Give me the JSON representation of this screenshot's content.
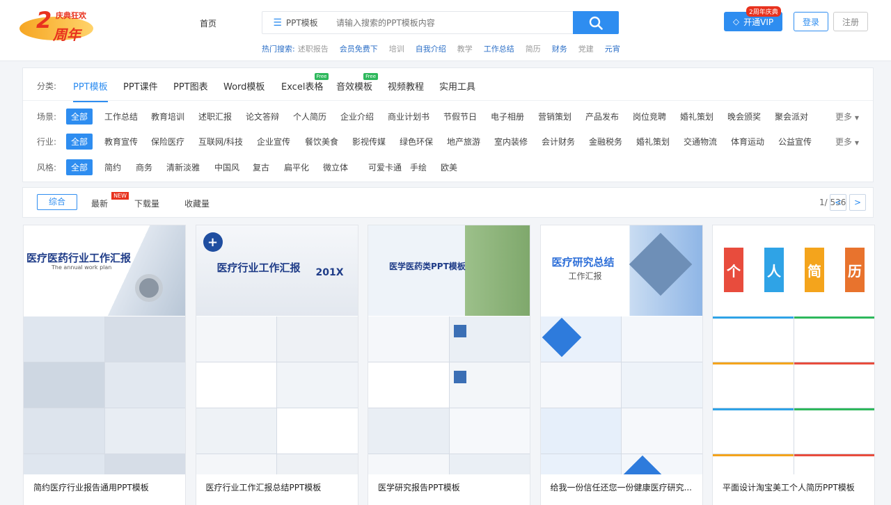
{
  "header": {
    "logo": {
      "caption": "庆典狂欢",
      "number": "2",
      "text": "周年"
    },
    "home": "首页",
    "search": {
      "category": "PPT模板",
      "placeholder": "请输入搜索的PPT模板内容"
    },
    "hot_label": "热门搜索:",
    "hot": [
      {
        "text": "述职报告",
        "style": "g"
      },
      {
        "text": "会员免费下",
        "style": "b"
      },
      {
        "text": "培训",
        "style": "g"
      },
      {
        "text": "自我介绍",
        "style": "b"
      },
      {
        "text": "教学",
        "style": "g"
      },
      {
        "text": "工作总结",
        "style": "b"
      },
      {
        "text": "简历",
        "style": "g"
      },
      {
        "text": "财务",
        "style": "b"
      },
      {
        "text": "党建",
        "style": "g"
      },
      {
        "text": "元宵",
        "style": "b"
      }
    ],
    "vip": {
      "label": "开通VIP",
      "tag": "2周年庆典"
    },
    "login": "登录",
    "register": "注册"
  },
  "filters": {
    "category_label": "分类:",
    "tabs": [
      "PPT模板",
      "PPT课件",
      "PPT图表",
      "Word模板",
      "Excel表格",
      "音效模板",
      "视频教程",
      "实用工具"
    ],
    "free_badge": "Free",
    "scene_label": "场景:",
    "scene": [
      "全部",
      "工作总结",
      "教育培训",
      "述职汇报",
      "论文答辩",
      "个人简历",
      "企业介绍",
      "商业计划书",
      "节假节日",
      "电子相册",
      "营销策划",
      "产品发布",
      "岗位竞聘",
      "婚礼策划",
      "晚会颁奖",
      "聚会派对"
    ],
    "industry_label": "行业:",
    "industry": [
      "全部",
      "教育宣传",
      "保险医疗",
      "互联网/科技",
      "企业宣传",
      "餐饮美食",
      "影视传媒",
      "绿色环保",
      "地产旅游",
      "室内装修",
      "会计财务",
      "金融税务",
      "婚礼策划",
      "交通物流",
      "体育运动",
      "公益宣传"
    ],
    "style_label": "风格:",
    "style": [
      "全部",
      "简约",
      "商务",
      "清新淡雅",
      "中国风",
      "复古",
      "扁平化",
      "微立体",
      "可爱卡通",
      "手绘",
      "欧美"
    ],
    "more": "更多"
  },
  "sort": {
    "options": [
      "综合",
      "最新",
      "下载量",
      "收藏量"
    ],
    "new_badge": "NEW",
    "page": "1/ 536",
    "prev": "<",
    "next": ">"
  },
  "cards": [
    {
      "title": "简约医疗行业报告通用PPT模板",
      "cover_title": "医疗医药行业工作汇报",
      "cover_sub": "The annual work plan"
    },
    {
      "title": "医疗行业工作汇报总结PPT模板",
      "cover_title": "医疗行业工作汇报",
      "cover_sub": "201X"
    },
    {
      "title": "医学研究报告PPT模板",
      "cover_title": "医学医药类PPT模板",
      "cover_sub": ""
    },
    {
      "title": "给我一份信任还您一份健康医疗研究...",
      "cover_title": "医疗研究总结",
      "cover_sub": "工作汇报"
    },
    {
      "title": "平面设计淘宝美工个人简历PPT模板",
      "cover_title": "个人简历",
      "cover_sub": ""
    }
  ],
  "resume_chars": [
    "个",
    "人",
    "简",
    "历"
  ],
  "colors": {
    "accent": "#2e8df0",
    "red": "#e8321e",
    "green": "#2eb85c"
  }
}
